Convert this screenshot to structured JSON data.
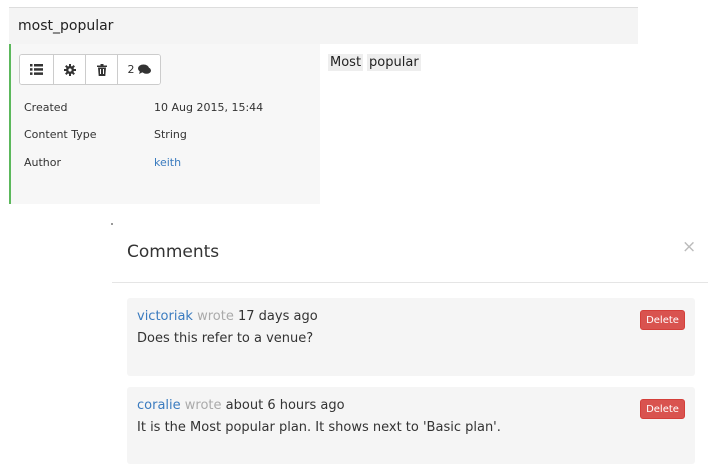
{
  "item": {
    "title": "most_popular",
    "toolbar": {
      "comment_count": "2"
    },
    "meta": [
      {
        "label": "Created",
        "value": "10 Aug 2015, 15:44"
      },
      {
        "label": "Content Type",
        "value": "String"
      },
      {
        "label": "Author",
        "value": "keith"
      }
    ],
    "tags": [
      "Most",
      "popular"
    ],
    "accent_color": "#5cb85c"
  },
  "comments_modal": {
    "title": "Comments",
    "close_symbol": "×",
    "comments": [
      {
        "user": "victoriak",
        "wrote": "wrote",
        "time": "17 days ago",
        "text": "Does this refer to a venue?",
        "delete_label": "Delete"
      },
      {
        "user": "coralie",
        "wrote": "wrote",
        "time": "about 6 hours ago",
        "text": "It is the Most popular plan. It shows next to 'Basic plan'.",
        "delete_label": "Delete"
      }
    ],
    "delete_color": "#d9534f",
    "link_color": "#3a7bbf"
  }
}
